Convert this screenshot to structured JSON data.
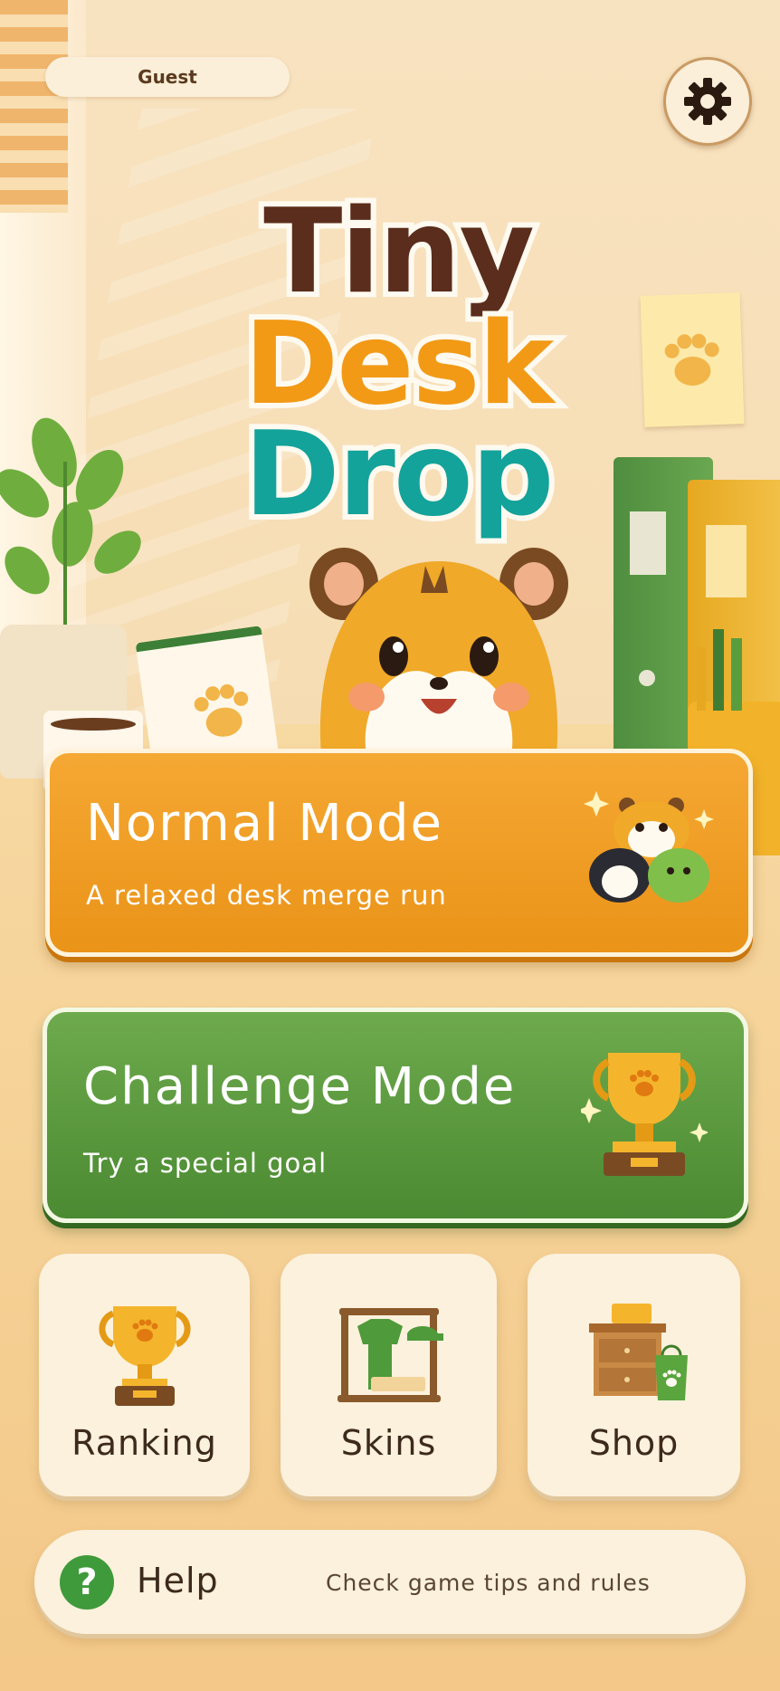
{
  "header": {
    "user_label": "Guest",
    "settings_icon": "gear-icon"
  },
  "logo": {
    "line1": "Tiny",
    "line2": "Desk",
    "line3": "Drop"
  },
  "modes": {
    "normal": {
      "title": "Normal Mode",
      "subtitle": "A relaxed desk merge run",
      "icon": "animal-friends-icon"
    },
    "challenge": {
      "title": "Challenge Mode",
      "subtitle": "Try a special goal",
      "icon": "trophy-icon"
    }
  },
  "tiles": [
    {
      "label": "Ranking",
      "icon": "trophy-icon"
    },
    {
      "label": "Skins",
      "icon": "clothes-rack-icon"
    },
    {
      "label": "Shop",
      "icon": "shop-drawer-icon"
    }
  ],
  "help": {
    "label": "Help",
    "description": "Check game tips and rules",
    "icon": "question-icon"
  },
  "colors": {
    "normal_card": "#f09f24",
    "challenge_card": "#5b9a3f",
    "logo_tiny": "#5b2d1c",
    "logo_desk": "#f29a16",
    "logo_drop": "#13a39a",
    "help_icon": "#3e9a3a"
  }
}
